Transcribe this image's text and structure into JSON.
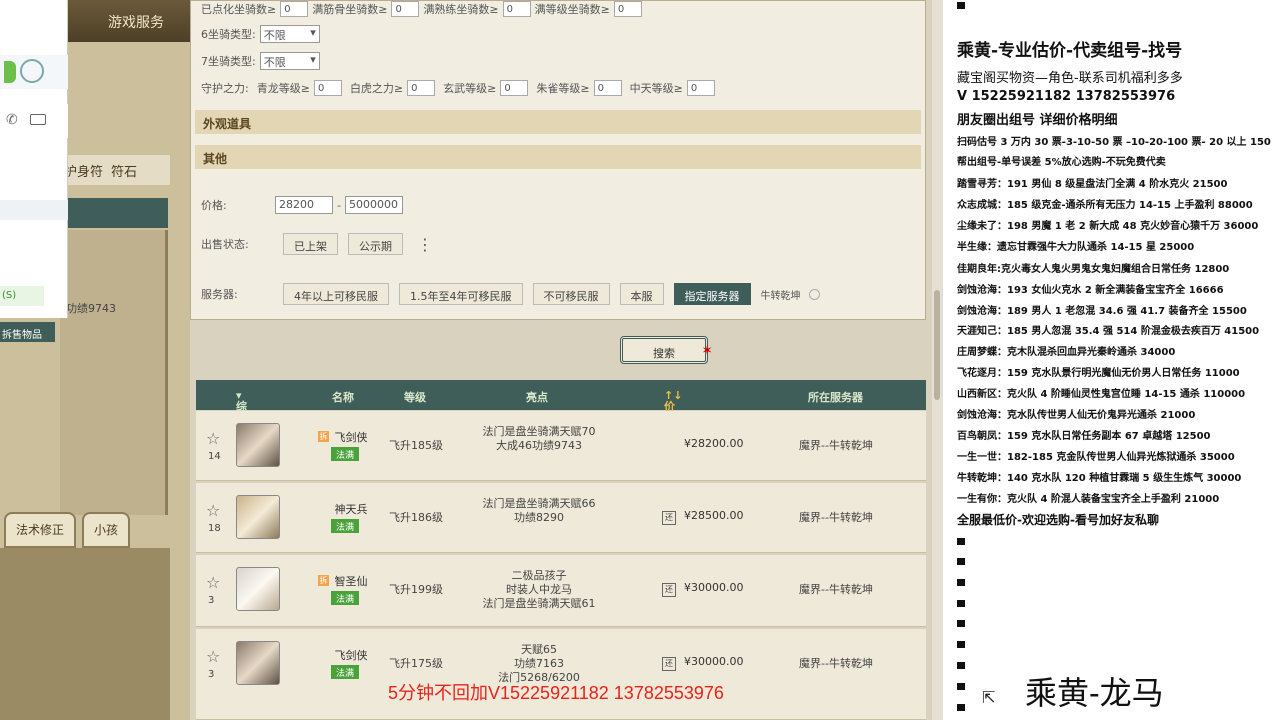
{
  "left_window": {
    "title": "游戏服务",
    "tabs": [
      "护身符",
      "符石"
    ],
    "bottom_tabs": [
      "法术修正",
      "小孩"
    ],
    "chat_badge": "(S)",
    "sell_button": "拆售物品",
    "left_text": "功绩9743"
  },
  "filters": {
    "row1": {
      "items": [
        "已点化坐骑数≥",
        "满筋骨坐骑数≥",
        "满熟练坐骑数≥",
        "满等级坐骑数≥"
      ],
      "values": [
        "0",
        "0",
        "0",
        "0"
      ]
    },
    "mount6": {
      "label": "6坐骑类型:",
      "value": "不限"
    },
    "mount7": {
      "label": "7坐骑类型:",
      "value": "不限"
    },
    "guard": {
      "label": "守护之力:",
      "items": [
        "青龙等级≥",
        "白虎之力≥",
        "玄武等级≥",
        "朱雀等级≥",
        "中天等级≥"
      ],
      "values": [
        "0",
        "0",
        "0",
        "0",
        "0"
      ]
    },
    "section_appearance": "外观道具",
    "section_other": "其他",
    "price_label": "价格:",
    "price_min": "28200",
    "price_max": "5000000",
    "price_sep": "-",
    "sale_label": "出售状态:",
    "sale_buttons": [
      "已上架",
      "公示期"
    ],
    "more_icon": "⋮",
    "server_label": "服务器:",
    "server_buttons": [
      "4年以上可移民服",
      "1.5年至4年可移民服",
      "不可移民服",
      "本服",
      "指定服务器"
    ],
    "server_value": "牛转乾坤",
    "search_label": "搜索"
  },
  "table": {
    "headers": [
      "综合排序",
      "名称",
      "等级",
      "亮点",
      "价格(元)",
      "所在服务器"
    ],
    "rows": [
      {
        "count": "14",
        "sale": "拆",
        "name": "飞剑侠",
        "tag": "法满",
        "level": "飞升185级",
        "highlights": [
          "法门是盘坐骑满天赋70",
          "大成46功绩9743"
        ],
        "ret": false,
        "price": "¥28200.00",
        "server": "魔界--牛转乾坤"
      },
      {
        "count": "18",
        "sale": "",
        "name": "神天兵",
        "tag": "法满",
        "level": "飞升186级",
        "highlights": [
          "法门是盘坐骑满天赋66",
          "功绩8290"
        ],
        "ret": true,
        "price": "¥28500.00",
        "server": "魔界--牛转乾坤"
      },
      {
        "count": "3",
        "sale": "拆",
        "name": "智圣仙",
        "tag": "法满",
        "level": "飞升199级",
        "highlights": [
          "二极品孩子",
          "时装人中龙马",
          "法门是盘坐骑满天赋61"
        ],
        "ret": true,
        "price": "¥30000.00",
        "server": "魔界--牛转乾坤"
      },
      {
        "count": "3",
        "sale": "",
        "name": "飞剑侠",
        "tag": "法满",
        "level": "飞升175级",
        "highlights": [
          "天赋65",
          "功绩7163",
          "法门5268/6200"
        ],
        "ret": true,
        "price": "¥30000.00",
        "server": "魔界--牛转乾坤"
      }
    ],
    "return_icon": "还"
  },
  "overlay_text": "5分钟不回加V15225921182  13782553976",
  "right_panel": {
    "lines": [
      "乘黄-专业估价-代卖组号-找号",
      "藏宝阁买物资—角色-联系司机福利多多",
      "V 15225921182    13782553976",
      "朋友圈出组号    详细价格明细",
      "扫码估号 3 万内 30 票-3-10-50 票  –10-20-100 票- 20 以上 150",
      "帮出组号-单号误差 5%放心选购-不玩免费代卖",
      "踏雪寻芳：191 男仙 8 级星盘法门全满 4 阶水克火 21500",
      "众志成城：185 级克金-通杀所有无压力 14-15 上手盈利 88000",
      "尘缘未了：198 男魔 1 老 2 新大成 48 克火妙音心猿千万 36000",
      "半生缘：遗忘甘霖强牛大力队通杀 14-15 星 25000",
      "佳期良年:克火毒女人鬼火男鬼女鬼妇魔组合日常任务 12800",
      "剑蚀沧海：193 女仙火克水 2 新全满装备宝宝齐全 16666",
      "剑蚀沧海：189 男人 1 老忽混 34.6 强 41.7 装备齐全 15500",
      "天涯知己：185 男人忽混 35.4 强 514 阶混金极去疾百万 41500",
      "庄周梦蝶：克木队混杀回血异光秦岭通杀 34000",
      "飞花逐月：159 克水队景行明光魔仙无价男人日常任务 11000",
      "山西新区：克火队 4 阶睡仙灵性鬼宫位睡 14-15 通杀 110000",
      "剑蚀沧海：克水队传世男人仙无价鬼异光通杀 21000",
      "百鸟朝凤：159 克水队日常任务副本 67 卓越塔 12500",
      "一生一世：182-185 克金队传世男人仙异光炼狱通杀 35000",
      "牛转乾坤：140 克水队 120 种植甘霖瑞 5 级生生炼气 30000",
      "一生有你：克火队 4 阶混人装备宝宝齐全上手盈利 21000",
      "全服最低价-欢迎选购-看号加好友私聊"
    ],
    "signature": "乘黄-龙马"
  },
  "colors": {
    "accent": "#3f5e59",
    "overlay_red": "#e8231a"
  }
}
